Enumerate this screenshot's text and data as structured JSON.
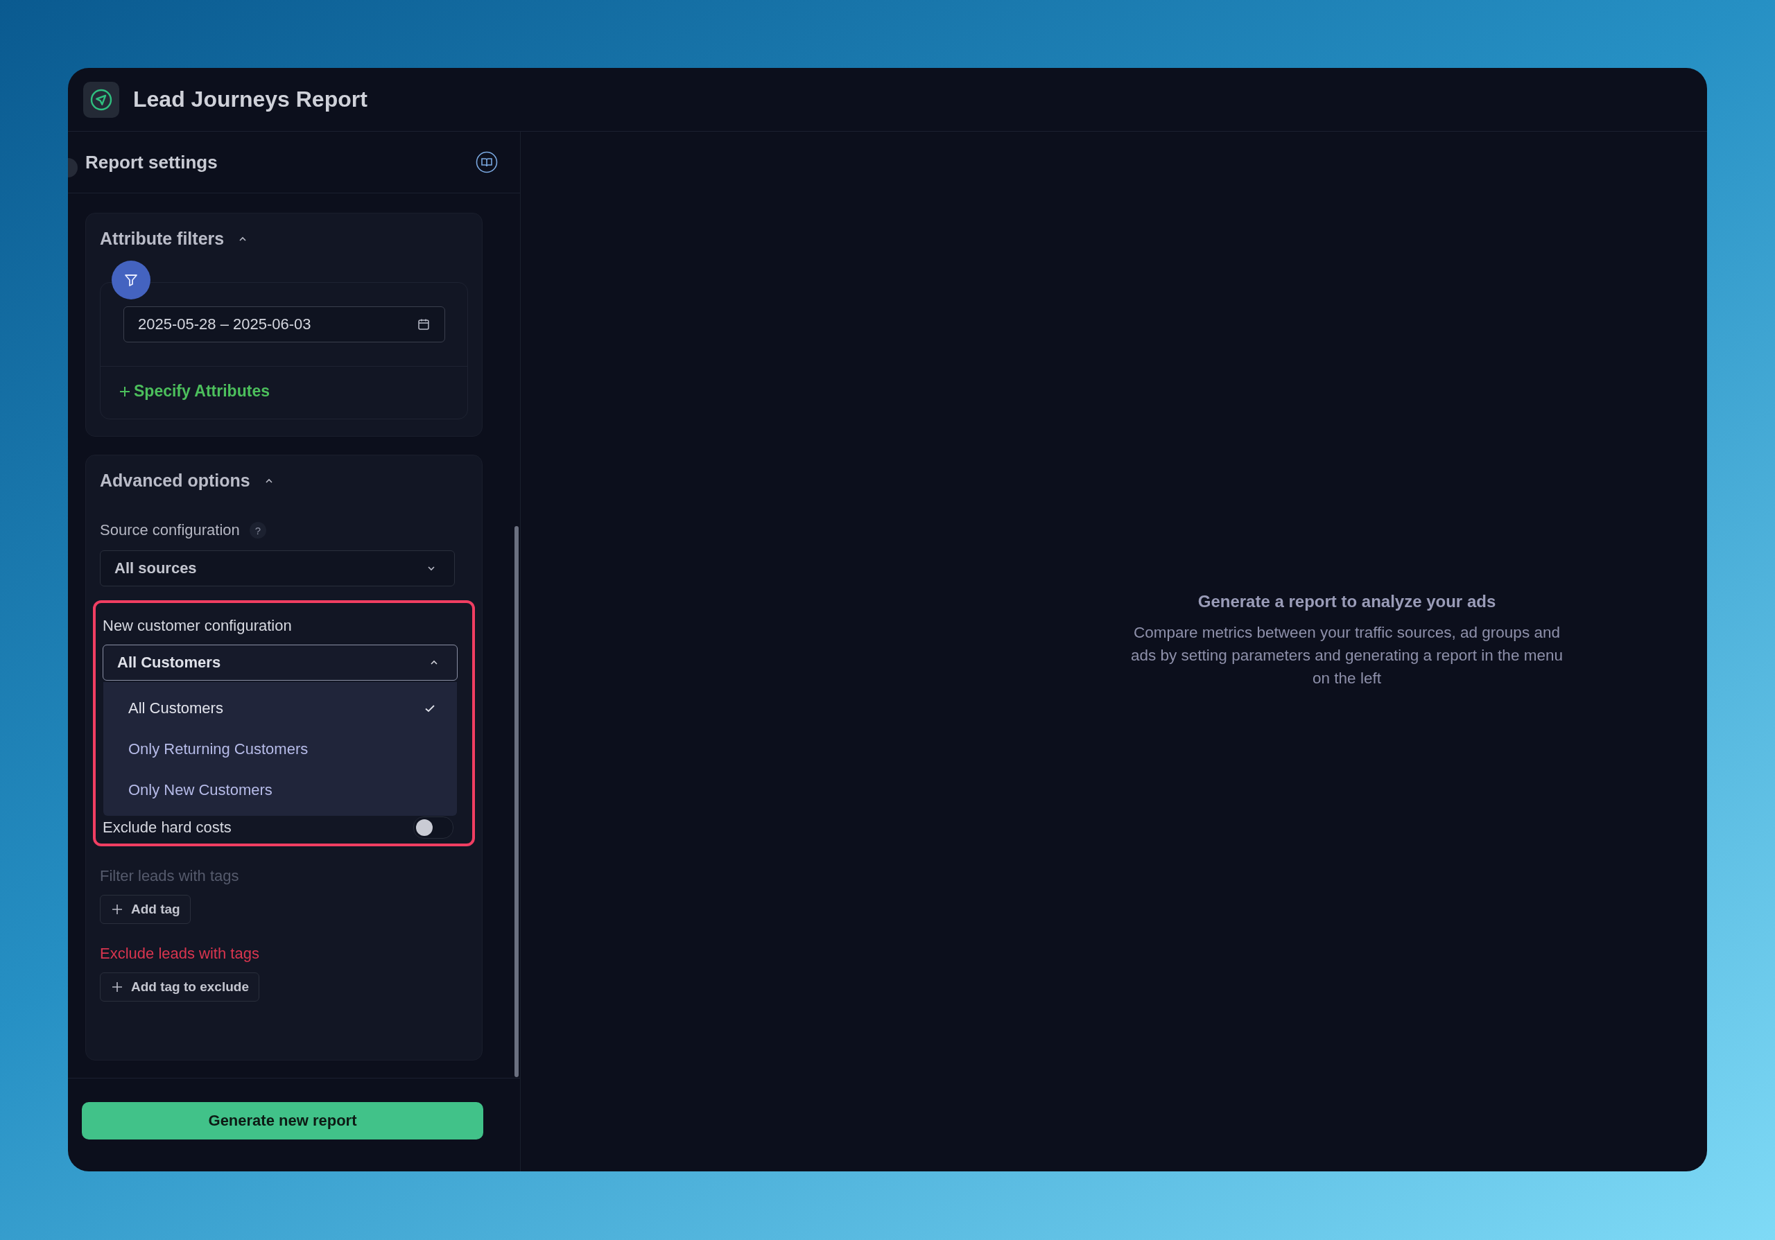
{
  "header": {
    "title": "Lead Journeys Report"
  },
  "settings": {
    "title": "Report settings",
    "attribute_filters": {
      "title": "Attribute filters",
      "expanded": true,
      "date_range": "2025-05-28 – 2025-06-03",
      "add_link": "Specify Attributes"
    },
    "advanced_options": {
      "title": "Advanced options",
      "expanded": true,
      "source_config": {
        "label": "Source configuration",
        "help": "?",
        "value": "All sources",
        "open": false
      },
      "customer_config": {
        "label": "New customer configuration",
        "value": "All Customers",
        "open": true,
        "highlighted": true,
        "options": [
          {
            "label": "All Customers",
            "selected": true
          },
          {
            "label": "Only Returning Customers",
            "selected": false
          },
          {
            "label": "Only New Customers",
            "selected": false
          }
        ]
      },
      "exclude_hard_costs": {
        "label": "Exclude hard costs",
        "on": false
      },
      "filter_tags": {
        "label": "Filter leads with tags",
        "button": "Add tag"
      },
      "exclude_tags": {
        "label": "Exclude leads with tags",
        "button": "Add tag to exclude"
      }
    },
    "generate_button": "Generate new report"
  },
  "empty_state": {
    "title": "Generate a report to analyze your ads",
    "text": "Compare metrics between your traffic sources, ad groups and ads by setting parameters and generating a report in the menu on the left"
  }
}
